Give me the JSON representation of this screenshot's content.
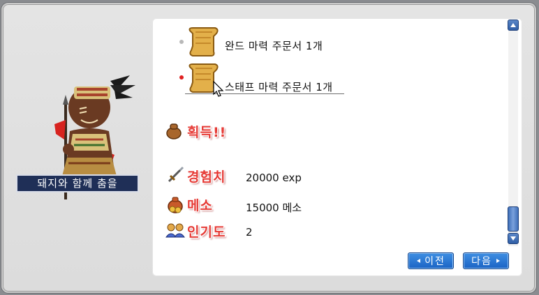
{
  "npc": {
    "name": "돼지와 함께 춤을"
  },
  "rewards": {
    "items": [
      {
        "label": "완드 마력 주문서 1개",
        "icon": "scroll-icon",
        "bullet_color": "#b8b8b8"
      },
      {
        "label": "스태프 마력 주문서 1개",
        "icon": "scroll-icon",
        "bullet_color": "#e02020"
      }
    ],
    "acquire_label": "획득!!",
    "exp_label": "경험치",
    "exp_value": "20000 exp",
    "meso_label": "메소",
    "meso_value": "15000 메소",
    "fame_label": "인기도",
    "fame_value": "2"
  },
  "buttons": {
    "prev_label": "이전",
    "next_label": "다음"
  },
  "colors": {
    "label_red": "#e63a35",
    "button_blue": "#1b63c4",
    "name_bar": "#1f2f57"
  }
}
